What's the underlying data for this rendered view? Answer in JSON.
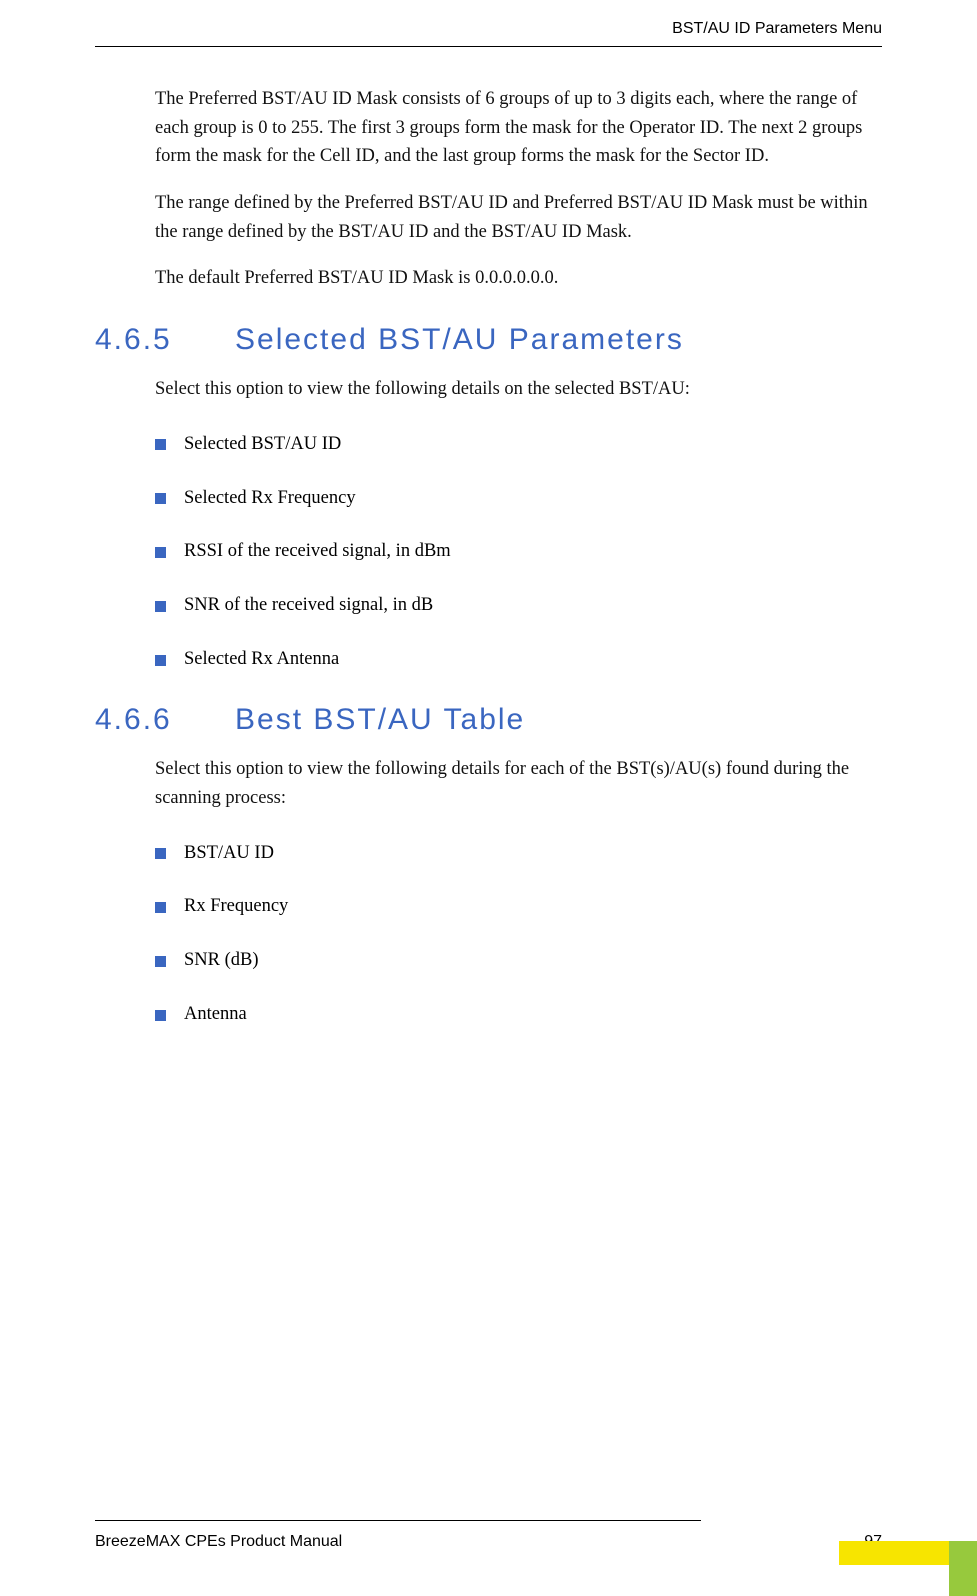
{
  "header": {
    "title": "BST/AU ID Parameters Menu"
  },
  "paragraphs": {
    "p1": "The Preferred BST/AU ID Mask consists of 6 groups of up to 3 digits each, where the range of each group is 0 to 255. The first 3 groups form the mask for the Operator ID. The next 2 groups form the mask for the Cell ID, and the last group forms the mask for the Sector ID.",
    "p2": "The range defined by the Preferred BST/AU ID and Preferred BST/AU ID Mask must be within the range defined by the BST/AU ID and the BST/AU ID Mask.",
    "p3": "The default Preferred BST/AU ID Mask is 0.0.0.0.0.0."
  },
  "sections": {
    "s1": {
      "num": "4.6.5",
      "title": "Selected BST/AU Parameters",
      "intro": "Select this option to view the following details on the selected BST/AU:",
      "items": {
        "i0": "Selected BST/AU ID",
        "i1": "Selected Rx Frequency",
        "i2": "RSSI of the received signal, in dBm",
        "i3": "SNR of the received signal, in dB",
        "i4": "Selected Rx Antenna"
      }
    },
    "s2": {
      "num": "4.6.6",
      "title": "Best BST/AU Table",
      "intro": "Select this option to view the following details for each of the BST(s)/AU(s) found during the scanning process:",
      "items": {
        "i0": "BST/AU ID",
        "i1": "Rx Frequency",
        "i2": "SNR (dB)",
        "i3": "Antenna"
      }
    }
  },
  "footer": {
    "manual": "BreezeMAX CPEs Product Manual",
    "page": "97"
  }
}
